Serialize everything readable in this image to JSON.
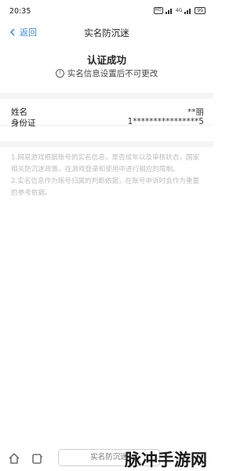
{
  "status_bar": {
    "time": "20:35",
    "hd": "HD",
    "signal_4g": "4G",
    "battery": "99"
  },
  "nav": {
    "back_label": "返回",
    "title": "实名防沉迷"
  },
  "result": {
    "title": "认证成功",
    "hint": "实名信息设置后不可更改"
  },
  "fields": [
    {
      "label": "姓名",
      "value": "**丽"
    },
    {
      "label": "身份证",
      "value": "1****************5"
    }
  ],
  "notes": [
    "1.网易游戏根据账号的实名信息，是否成年以及审核状态，国家相关防沉迷政策，在游戏登录和使用中进行相应的限制。",
    "2.实名信息作为账号归属的判断依据，在账号申诉时会作为重要的参考依据。"
  ],
  "bottom_bar": {
    "url_text": "实名防沉迷"
  },
  "watermark": "脉冲手游网",
  "colors": {
    "accent": "#2f8be6",
    "note_text": "#bdbdbd",
    "divider": "#f5f5f5"
  }
}
